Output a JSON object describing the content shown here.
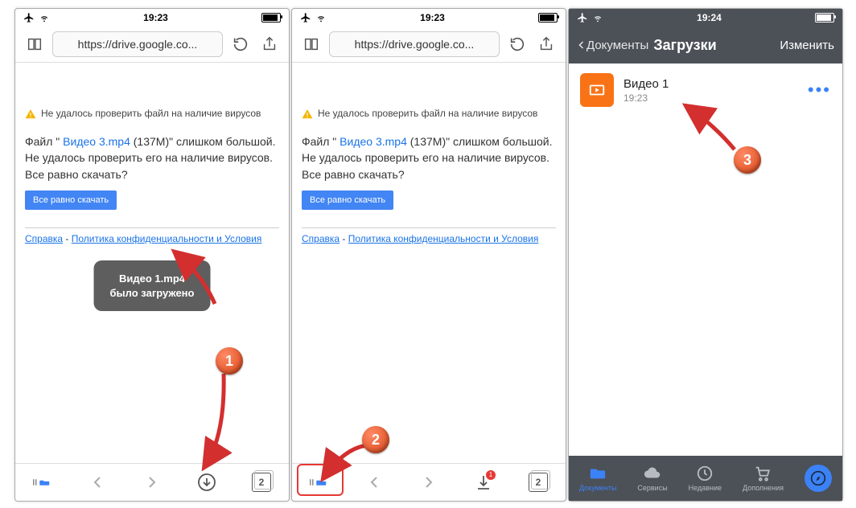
{
  "status": {
    "time12": "19:23",
    "time3": "19:24"
  },
  "browser": {
    "url": "https://drive.google.co...",
    "warn": "Не удалось проверить файл на наличие вирусов",
    "msg_prefix": "Файл \"",
    "file_link": " Видео 3.mp4",
    "msg_suffix": " (137M)\" слишком большой. Не удалось проверить его на наличие вирусов. Все равно скачать?",
    "download_button": "Все равно скачать",
    "help": "Справка",
    "policy": "Политика конфиденциальности и Условия",
    "sep": " - ",
    "tab_count": "2",
    "badge_count": "1"
  },
  "toast": {
    "line1": "Видео 1.mp4",
    "line2": "было загружено"
  },
  "p3": {
    "back": "Документы",
    "title": "Загрузки",
    "edit": "Изменить",
    "file_name": "Видео 1",
    "file_time": "19:23",
    "tabs": {
      "documents": "Документы",
      "services": "Сервисы",
      "recent": "Недавние",
      "addons": "Дополнения"
    }
  },
  "steps": {
    "s1": "1",
    "s2": "2",
    "s3": "3"
  }
}
